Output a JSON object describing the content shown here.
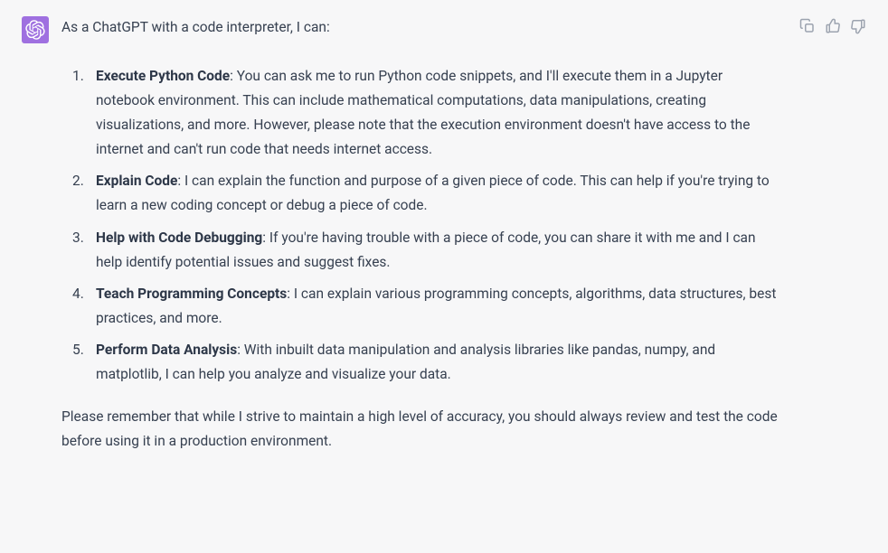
{
  "intro": "As a ChatGPT with a code interpreter, I can:",
  "items": [
    {
      "title": "Execute Python Code",
      "body": ": You can ask me to run Python code snippets, and I'll execute them in a Jupyter notebook environment. This can include mathematical computations, data manipulations, creating visualizations, and more. However, please note that the execution environment doesn't have access to the internet and can't run code that needs internet access."
    },
    {
      "title": "Explain Code",
      "body": ": I can explain the function and purpose of a given piece of code. This can help if you're trying to learn a new coding concept or debug a piece of code."
    },
    {
      "title": "Help with Code Debugging",
      "body": ": If you're having trouble with a piece of code, you can share it with me and I can help identify potential issues and suggest fixes."
    },
    {
      "title": "Teach Programming Concepts",
      "body": ": I can explain various programming concepts, algorithms, data structures, best practices, and more."
    },
    {
      "title": "Perform Data Analysis",
      "body": ": With inbuilt data manipulation and analysis libraries like pandas, numpy, and matplotlib, I can help you analyze and visualize your data."
    }
  ],
  "outro": "Please remember that while I strive to maintain a high level of accuracy, you should always review and test the code before using it in a production environment."
}
